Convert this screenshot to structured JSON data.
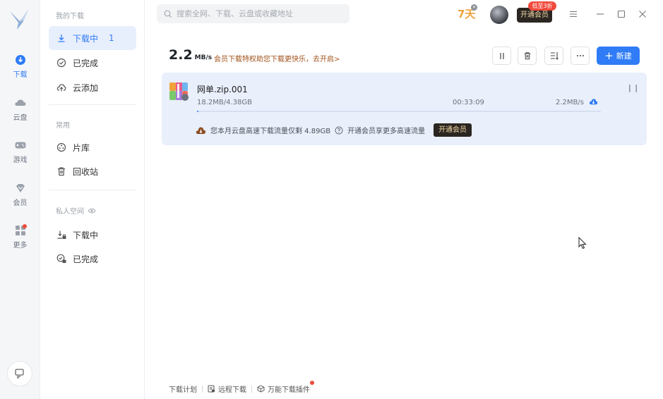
{
  "rail": {
    "items": [
      {
        "label": "下载",
        "icon": "download-circle-icon"
      },
      {
        "label": "云盘",
        "icon": "cloud-icon"
      },
      {
        "label": "游戏",
        "icon": "gamepad-icon"
      },
      {
        "label": "会员",
        "icon": "diamond-icon"
      },
      {
        "label": "更多",
        "icon": "grid-icon"
      }
    ]
  },
  "nav": {
    "section_downloads": "我的下载",
    "downloading": "下载中",
    "downloading_count": "1",
    "completed": "已完成",
    "cloud_add": "云添加",
    "section_common": "常用",
    "library": "片库",
    "recycle": "回收站",
    "section_private": "私人空间",
    "private_downloading": "下载中",
    "private_completed": "已完成"
  },
  "topbar": {
    "search_placeholder": "搜索全网、下载、云盘或收藏地址",
    "seven_days": "7天",
    "vip_button": "开通会员",
    "vip_badge": "低至3折"
  },
  "main": {
    "speed_value": "2.2",
    "speed_unit": "MB/s",
    "promo_text": "会员下载特权助您下载更快乐，去开启>",
    "new_button": "新建"
  },
  "task": {
    "file_name": "网单.zip.001",
    "size_progress": "18.2MB/4.38GB",
    "time_remaining": "00:33:09",
    "speed": "2.2MB/s",
    "progress_fraction": 0.004,
    "quota_text": "您本月云盘高速下载流量仅剩 4.89GB",
    "quota_hint": "开通会员享更多高速流量",
    "quota_button": "开通会员"
  },
  "footer": {
    "plan": "下载计划",
    "remote": "远程下载",
    "plugin": "万能下载插件"
  },
  "colors": {
    "accent": "#2f7cf6",
    "card_bg": "#e9effb",
    "vip_dark": "#2b2621",
    "vip_gold": "#f4d9a8",
    "badge_red": "#f04a3c",
    "promo_brown": "#a0521a"
  }
}
